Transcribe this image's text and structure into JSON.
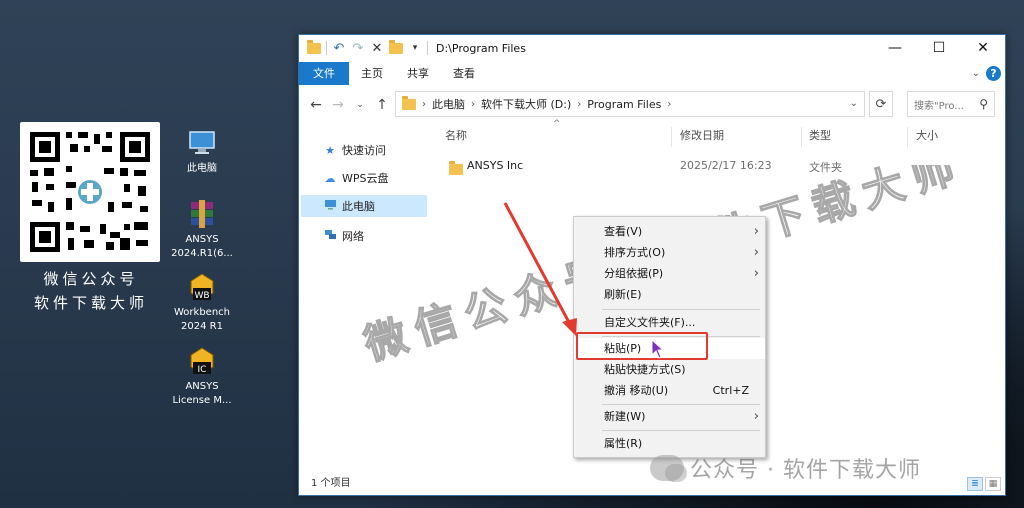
{
  "desktop": {
    "qr_caption_line1": "微信公众号",
    "qr_caption_line2": "软件下载大师",
    "icons": [
      {
        "label": "此电脑",
        "icon": "computer-icon"
      },
      {
        "label": "ANSYS 2024.R1(6...",
        "icon": "winrar-archive-icon"
      },
      {
        "label": "Workbench 2024 R1",
        "icon": "ansys-workbench-icon"
      },
      {
        "label": "ANSYS License M...",
        "icon": "ansys-license-icon"
      }
    ]
  },
  "window": {
    "title": "D:\\Program Files",
    "controls": {
      "minimize": "—",
      "maximize": "☐",
      "close": "✕"
    },
    "ribbon_tabs": [
      "文件",
      "主页",
      "共享",
      "查看"
    ],
    "active_tab": "文件",
    "help_glyph": "?",
    "address": {
      "crumbs": [
        "此电脑",
        "软件下载大师 (D:)",
        "Program Files"
      ]
    },
    "search_placeholder": "搜索\"Pro...",
    "nav_pane": [
      {
        "label": "快速访问",
        "icon": "star-pin-icon",
        "color": "#2f7ed8"
      },
      {
        "label": "WPS云盘",
        "icon": "cloud-icon",
        "color": "#3d8bf2"
      },
      {
        "label": "此电脑",
        "icon": "computer-icon",
        "color": "#2f6fb6",
        "selected": true
      },
      {
        "label": "网络",
        "icon": "network-icon",
        "color": "#2f6fb6"
      }
    ],
    "columns": [
      "名称",
      "修改日期",
      "类型",
      "大小"
    ],
    "files": [
      {
        "name": "ANSYS Inc",
        "modified": "2025/2/17 16:23",
        "type": "文件夹",
        "size": ""
      }
    ],
    "status": "1 个项目"
  },
  "context_menu": {
    "items": [
      {
        "label": "查看(V)",
        "submenu": true
      },
      {
        "label": "排序方式(O)",
        "submenu": true
      },
      {
        "label": "分组依据(P)",
        "submenu": true
      },
      {
        "label": "刷新(E)"
      },
      {
        "separator": true
      },
      {
        "label": "自定义文件夹(F)..."
      },
      {
        "separator": true
      },
      {
        "label": "粘贴(P)",
        "highlighted": true
      },
      {
        "label": "粘贴快捷方式(S)"
      },
      {
        "label": "撤消 移动(U)",
        "shortcut": "Ctrl+Z"
      },
      {
        "separator": true
      },
      {
        "label": "新建(W)",
        "submenu": true
      },
      {
        "separator": true
      },
      {
        "label": "属性(R)"
      }
    ]
  },
  "watermark": {
    "diagonal": "微信公众号：软件下载大师",
    "bottom": "公众号 · 软件下载大师"
  },
  "colors": {
    "accent": "#1979ca",
    "highlight_box": "#e23a2e",
    "selection": "#cce8ff"
  }
}
